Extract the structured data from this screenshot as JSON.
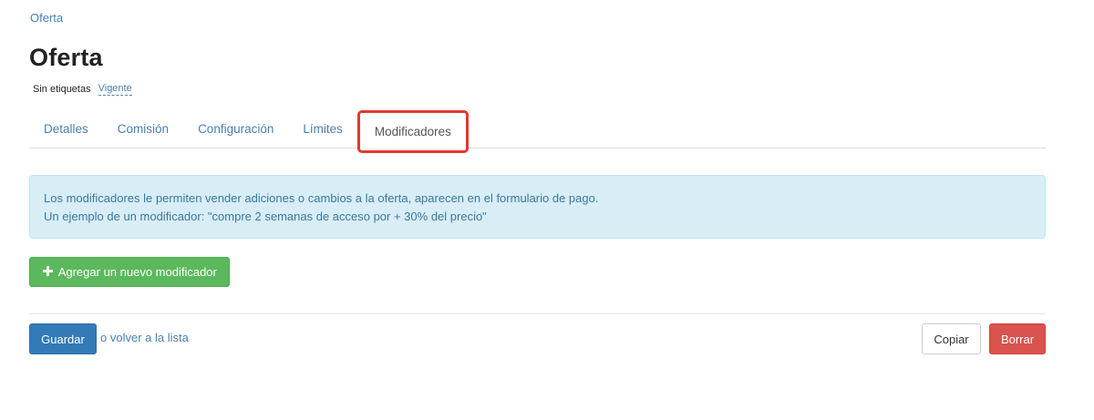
{
  "breadcrumb": {
    "label": "Oferta"
  },
  "header": {
    "title": "Oferta",
    "tags_label": "Sin etiquetas",
    "status_label": "Vigente"
  },
  "tabs": [
    {
      "label": "Detalles",
      "active": false
    },
    {
      "label": "Comisión",
      "active": false
    },
    {
      "label": "Configuración",
      "active": false
    },
    {
      "label": "Límites",
      "active": false
    },
    {
      "label": "Modificadores",
      "active": true
    }
  ],
  "info": {
    "line1": "Los modificadores le permiten vender adiciones o cambios a la oferta, aparecen en el formulario de pago.",
    "line2": "Un ejemplo de un modificador: \"compre 2 semanas de acceso por + 30% del precio\""
  },
  "actions": {
    "add_modifier_label": "Agregar un nuevo modificador",
    "add_modifier_icon": "plus-icon",
    "save_label": "Guardar",
    "back_link_label": "o volver a la lista",
    "copy_label": "Copiar",
    "delete_label": "Borrar"
  },
  "colors": {
    "link": "#4a7fb0",
    "primary": "#337ab7",
    "success": "#5cb85c",
    "danger": "#d9534f",
    "info_bg": "#d9edf7",
    "highlight": "#e03a2f"
  }
}
